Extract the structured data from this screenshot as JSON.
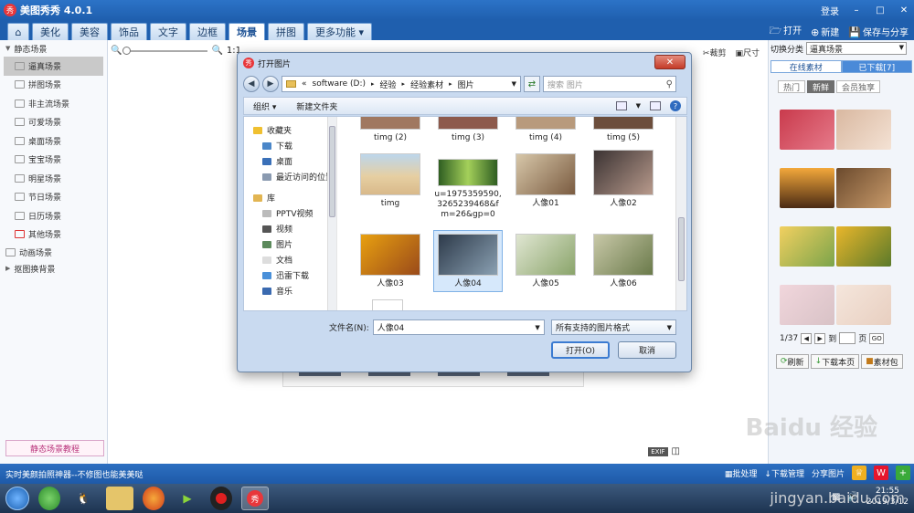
{
  "app": {
    "title": "美图秀秀 4.0.1",
    "logo": "秀",
    "login": "登录",
    "window_controls": [
      "–",
      "□",
      "✕"
    ]
  },
  "menu": {
    "tabs": [
      "美化",
      "美容",
      "饰品",
      "文字",
      "边框",
      "场景",
      "拼图",
      "更多功能 ▾"
    ],
    "active": "场景",
    "right": {
      "open": "打开",
      "new": "新建",
      "save_share": "保存与分享"
    }
  },
  "sidebar": {
    "group_static": "静态场景",
    "items": [
      "逼真场景",
      "拼图场景",
      "非主流场景",
      "可爱场景",
      "桌面场景",
      "宝宝场景",
      "明星场景",
      "节日场景",
      "日历场景",
      "其他场景"
    ],
    "selected": "逼真场景",
    "group_animated": "动画场景",
    "group_cutout": "抠图换背景",
    "tutorial": "静态场景教程"
  },
  "canvas": {
    "zoom_label": "1:1",
    "crop": "裁剪",
    "size": "尺寸",
    "exif": "EXIF"
  },
  "right_panel": {
    "switch_label": "切换分类",
    "switch_value": "逼真场景",
    "tabs": [
      "在线素材",
      "已下载[7]"
    ],
    "active_tab": "在线素材",
    "sub_tabs": [
      "热门",
      "新鲜",
      "会员独享"
    ],
    "active_sub": "新鲜",
    "page": "1/37",
    "to": "到",
    "page_unit": "页",
    "go": "GO",
    "refresh": "刷新",
    "download_page": "下载本页",
    "library": "素材包"
  },
  "status": {
    "tip": "实时美颜拍照神器--不修图也能美美哒",
    "batch": "批处理",
    "download_mgr": "下载管理",
    "share": "分享图片"
  },
  "dialog": {
    "title": "打开图片",
    "path": [
      "«",
      "software (D:)",
      "▸",
      "经验",
      "▸",
      "经验素材",
      "▸",
      "图片"
    ],
    "search_placeholder": "搜索 图片",
    "organize": "组织 ▾",
    "new_folder": "新建文件夹",
    "nav": {
      "favorites": "收藏夹",
      "downloads": "下载",
      "desktop": "桌面",
      "recent": "最近访问的位置",
      "library": "库",
      "pptv": "PPTV视频",
      "video": "视频",
      "pictures": "图片",
      "docs": "文档",
      "xunlei": "迅雷下载",
      "music": "音乐"
    },
    "files_top": [
      "timg (2)",
      "timg (3)",
      "timg (4)",
      "timg (5)"
    ],
    "files_row2": [
      "timg",
      "u=1975359590,3265239468&fm=26&gp=0",
      "人像01",
      "人像02"
    ],
    "files_row3": [
      "人像03",
      "人像04",
      "人像05",
      "人像06"
    ],
    "selected_file": "人像04",
    "filename_label": "文件名(N):",
    "filename_value": "人像04",
    "filter": "所有支持的图片格式",
    "open": "打开(O)",
    "cancel": "取消"
  },
  "taskbar": {
    "time": "21:55",
    "date": "2019/3/12"
  },
  "watermark": {
    "text": "Baidu 经验",
    "url": "jingyan.baidu.com"
  }
}
